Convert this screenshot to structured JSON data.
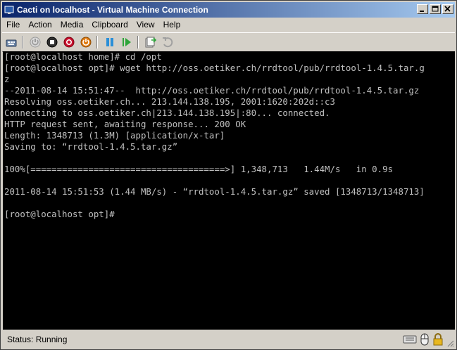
{
  "window": {
    "title": "Cacti on localhost - Virtual Machine Connection"
  },
  "menu": [
    "File",
    "Action",
    "Media",
    "Clipboard",
    "View",
    "Help"
  ],
  "toolbar": {
    "icons": [
      "ctrl-alt-del-icon",
      "start-icon",
      "turn-off-icon",
      "shut-down-icon",
      "save-icon",
      "pause-icon",
      "resume-icon",
      "snapshot-icon",
      "revert-icon"
    ]
  },
  "terminal": {
    "lines": [
      "[root@localhost home]# cd /opt",
      "[root@localhost opt]# wget http://oss.oetiker.ch/rrdtool/pub/rrdtool-1.4.5.tar.g",
      "z",
      "--2011-08-14 15:51:47--  http://oss.oetiker.ch/rrdtool/pub/rrdtool-1.4.5.tar.gz",
      "Resolving oss.oetiker.ch... 213.144.138.195, 2001:1620:202d::c3",
      "Connecting to oss.oetiker.ch|213.144.138.195|:80... connected.",
      "HTTP request sent, awaiting response... 200 OK",
      "Length: 1348713 (1.3M) [application/x-tar]",
      "Saving to: “rrdtool-1.4.5.tar.gz”",
      "",
      "100%[=====================================>] 1,348,713   1.44M/s   in 0.9s",
      "",
      "2011-08-14 15:51:53 (1.44 MB/s) - “rrdtool-1.4.5.tar.gz” saved [1348713/1348713]",
      "",
      "[root@localhost opt]#"
    ]
  },
  "status": {
    "text": "Status: Running"
  },
  "colors": {
    "titlebar_start": "#0a246a",
    "titlebar_end": "#a6caf0",
    "terminal_bg": "#000000",
    "terminal_fg": "#c0c0c0",
    "chrome": "#d4d0c8"
  }
}
